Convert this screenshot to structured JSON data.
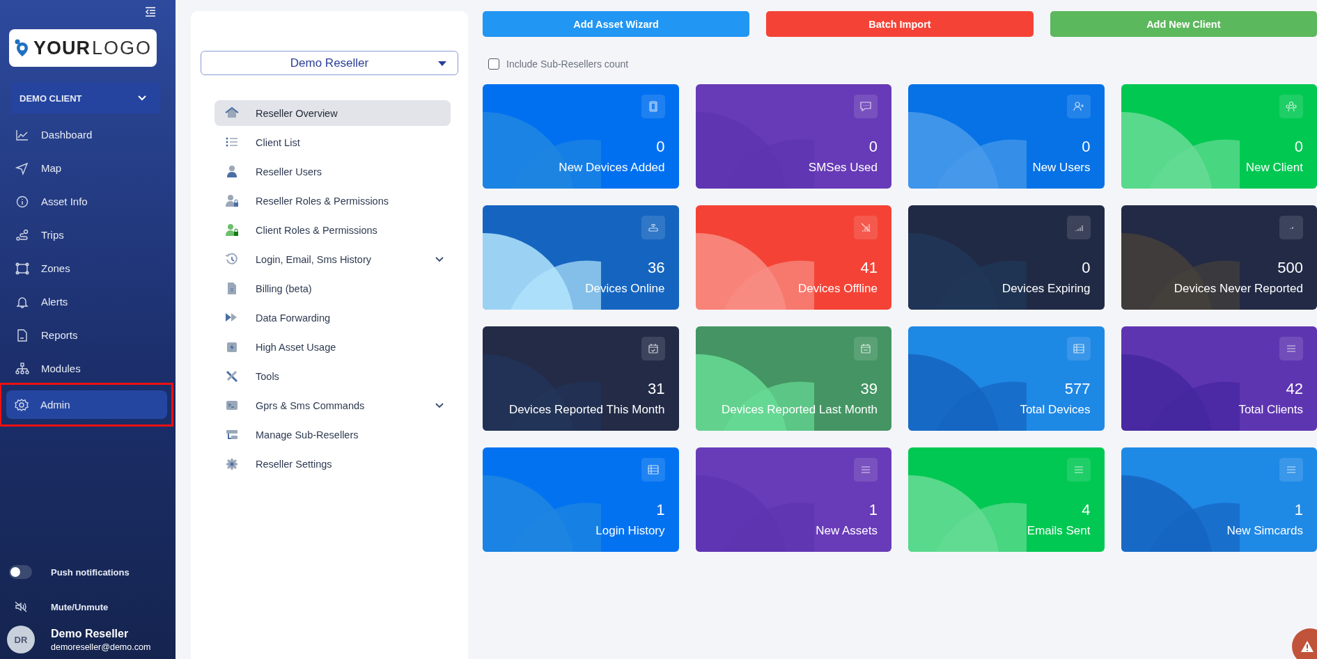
{
  "sidebar": {
    "logo": {
      "bold": "YOUR",
      "light": "LOGO"
    },
    "client_select": {
      "value": "DEMO CLIENT"
    },
    "items": [
      {
        "label": "Dashboard",
        "selected": false,
        "highlighted": false
      },
      {
        "label": "Map",
        "selected": false,
        "highlighted": false
      },
      {
        "label": "Asset Info",
        "selected": false,
        "highlighted": false
      },
      {
        "label": "Trips",
        "selected": false,
        "highlighted": false
      },
      {
        "label": "Zones",
        "selected": false,
        "highlighted": false
      },
      {
        "label": "Alerts",
        "selected": false,
        "highlighted": false
      },
      {
        "label": "Reports",
        "selected": false,
        "highlighted": false
      },
      {
        "label": "Modules",
        "selected": false,
        "highlighted": false
      },
      {
        "label": "Admin",
        "selected": true,
        "highlighted": true
      }
    ],
    "push_notifications": {
      "label": "Push notifications",
      "on": false
    },
    "mute": {
      "label": "Mute/Unmute"
    },
    "user": {
      "initials": "DR",
      "name": "Demo Reseller",
      "email": "demoreseller@demo.com"
    }
  },
  "reseller_panel": {
    "select": {
      "value": "Demo Reseller"
    },
    "items": [
      {
        "label": "Reseller Overview",
        "selected": true,
        "has_submenu": false
      },
      {
        "label": "Client List",
        "selected": false,
        "has_submenu": false
      },
      {
        "label": "Reseller Users",
        "selected": false,
        "has_submenu": false
      },
      {
        "label": "Reseller Roles & Permissions",
        "selected": false,
        "has_submenu": false
      },
      {
        "label": "Client Roles & Permissions",
        "selected": false,
        "has_submenu": false
      },
      {
        "label": "Login, Email, Sms History",
        "selected": false,
        "has_submenu": true
      },
      {
        "label": "Billing (beta)",
        "selected": false,
        "has_submenu": false
      },
      {
        "label": "Data Forwarding",
        "selected": false,
        "has_submenu": false
      },
      {
        "label": "High Asset Usage",
        "selected": false,
        "has_submenu": false
      },
      {
        "label": "Tools",
        "selected": false,
        "has_submenu": false
      },
      {
        "label": "Gprs & Sms Commands",
        "selected": false,
        "has_submenu": true
      },
      {
        "label": "Manage Sub-Resellers",
        "selected": false,
        "has_submenu": false
      },
      {
        "label": "Reseller Settings",
        "selected": false,
        "has_submenu": false
      }
    ]
  },
  "actions": [
    {
      "label": "Add Asset Wizard",
      "color": "#2196f3"
    },
    {
      "label": "Batch Import",
      "color": "#f44336"
    },
    {
      "label": "Add New Client",
      "color": "#5cb85c"
    }
  ],
  "include_sub_resellers": {
    "label": "Include Sub-Resellers count",
    "checked": false
  },
  "cards": [
    {
      "value": "0",
      "label": "New Devices Added",
      "color": "#0170f0"
    },
    {
      "value": "0",
      "label": "SMSes Used",
      "color": "#673ab7"
    },
    {
      "value": "0",
      "label": "New Users",
      "color": "#0672e6"
    },
    {
      "value": "0",
      "label": "New Client",
      "color": "#00c851"
    },
    {
      "value": "36",
      "label": "Devices Online",
      "color": "#1565c0"
    },
    {
      "value": "41",
      "label": "Devices Offline",
      "color": "#f44336"
    },
    {
      "value": "0",
      "label": "Devices Expiring",
      "color": "#212a45"
    },
    {
      "value": "500",
      "label": "Devices Never Reported",
      "color": "#222a46"
    },
    {
      "value": "31",
      "label": "Devices Reported This Month",
      "color": "#232b47"
    },
    {
      "value": "39",
      "label": "Devices Reported Last Month",
      "color": "#449563"
    },
    {
      "value": "577",
      "label": "Total Devices",
      "color": "#1e88e5"
    },
    {
      "value": "42",
      "label": "Total Clients",
      "color": "#5e35b1"
    },
    {
      "value": "1",
      "label": "Login History",
      "color": "#0272f1"
    },
    {
      "value": "1",
      "label": "New Assets",
      "color": "#683bb8"
    },
    {
      "value": "4",
      "label": "Emails Sent",
      "color": "#01c852"
    },
    {
      "value": "1",
      "label": "New Simcards",
      "color": "#1f89e6"
    }
  ]
}
